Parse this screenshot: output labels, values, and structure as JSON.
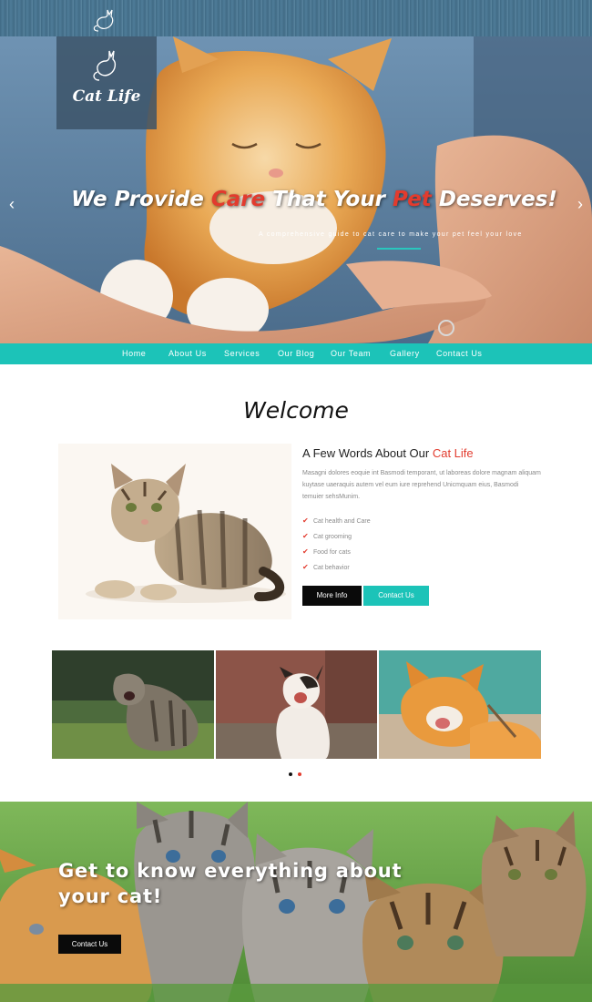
{
  "site": {
    "logo_text": "Cat Life"
  },
  "hero": {
    "title_part1": "We Provide ",
    "title_accent1": "Care",
    "title_part2": " That Your ",
    "title_accent2": "Pet",
    "title_part3": " Deserves!",
    "subtitle": "A comprehensive guide to cat care to make your pet feel your love",
    "prev_arrow": "‹",
    "next_arrow": "›"
  },
  "nav": {
    "items": [
      "Home",
      "About Us",
      "Services",
      "Our Blog",
      "Our Team",
      "Gallery",
      "Contact Us"
    ]
  },
  "welcome": {
    "title": "Welcome",
    "heading_prefix": "A Few Words About Our ",
    "heading_accent": "Cat Life",
    "paragraph": "Masagni dolores eoquie int Basmodi temporant, ut laboreas dolore magnam aliquam kuytase uaeraquis autem vel eum iure reprehend Unicmquam eius, Basmodi temuier sehsMunim.",
    "bullets": [
      "Cat health and Care",
      "Cat grooming",
      "Food for cats",
      "Cat behavior"
    ],
    "check_glyph": "✔",
    "more_button": "More Info",
    "contact_button": "Contact Us"
  },
  "gallery": {
    "active_dot": 1
  },
  "banner": {
    "title": "Get to know everything about your cat!",
    "button": "Contact Us"
  },
  "colors": {
    "accent_red": "#e23b2e",
    "teal": "#1cc3b8",
    "dark": "#0a0a0a"
  }
}
